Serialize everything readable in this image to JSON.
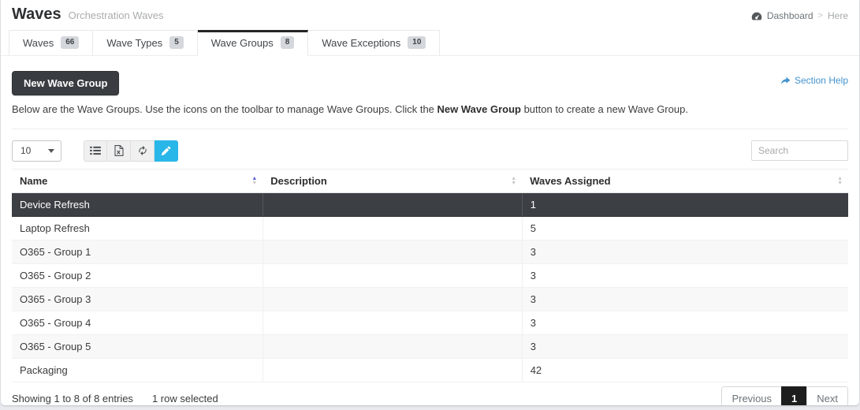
{
  "page": {
    "title": "Waves",
    "subtitle": "Orchestration Waves",
    "breadcrumb": {
      "icon": "dashboard-icon",
      "home": "Dashboard",
      "separator": ">",
      "current": "Here"
    }
  },
  "tabs": [
    {
      "label": "Waves",
      "count": "66",
      "active": false
    },
    {
      "label": "Wave Types",
      "count": "5",
      "active": false
    },
    {
      "label": "Wave Groups",
      "count": "8",
      "active": true
    },
    {
      "label": "Wave Exceptions",
      "count": "10",
      "active": false
    }
  ],
  "actions": {
    "new_button": "New Wave Group",
    "section_help": "Section Help",
    "section_help_icon": "forward-arrow-icon"
  },
  "description": {
    "before": "Below are the Wave Groups. Use the icons on the toolbar to manage Wave Groups. Click the ",
    "bold": "New Wave Group",
    "after": " button to create a new Wave Group."
  },
  "toolbar": {
    "page_size": "10",
    "button_icons": [
      "list-view-icon",
      "excel-export-icon",
      "refresh-icon",
      "edit-pencil-icon"
    ],
    "active_button": "edit-pencil-icon",
    "search_placeholder": "Search"
  },
  "table": {
    "columns": [
      {
        "label": "Name",
        "sort": "asc"
      },
      {
        "label": "Description",
        "sort": "none"
      },
      {
        "label": "Waves Assigned",
        "sort": "none"
      }
    ],
    "rows": [
      {
        "name": "Device Refresh",
        "description": "",
        "waves_assigned": "1",
        "selected": true
      },
      {
        "name": "Laptop Refresh",
        "description": "",
        "waves_assigned": "5",
        "selected": false
      },
      {
        "name": "O365 - Group 1",
        "description": "",
        "waves_assigned": "3",
        "selected": false
      },
      {
        "name": "O365 - Group 2",
        "description": "",
        "waves_assigned": "3",
        "selected": false
      },
      {
        "name": "O365 - Group 3",
        "description": "",
        "waves_assigned": "3",
        "selected": false
      },
      {
        "name": "O365 - Group 4",
        "description": "",
        "waves_assigned": "3",
        "selected": false
      },
      {
        "name": "O365 - Group 5",
        "description": "",
        "waves_assigned": "3",
        "selected": false
      },
      {
        "name": "Packaging",
        "description": "",
        "waves_assigned": "42",
        "selected": false
      }
    ]
  },
  "footer": {
    "showing": "Showing 1 to 8 of 8 entries",
    "selected": "1 row selected",
    "pagination": {
      "previous": "Previous",
      "page": "1",
      "next": "Next"
    }
  },
  "colors": {
    "accent_cyan": "#29b6e8",
    "dark_button": "#393d41",
    "selected_row": "#3c4045",
    "link_blue": "#4493cd",
    "sort_active": "#5a62d2",
    "active_page": "#1d1d1d"
  }
}
